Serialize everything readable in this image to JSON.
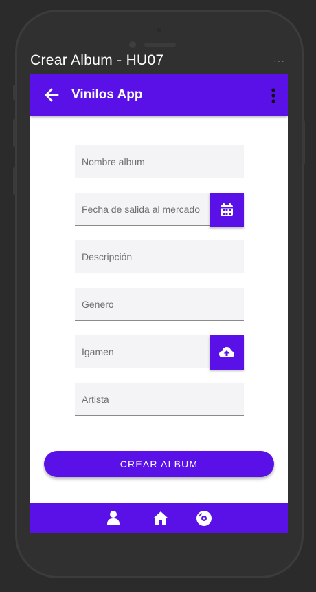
{
  "frame": {
    "title": "Crear Album - HU07",
    "dots": "···"
  },
  "appbar": {
    "title": "Vinilos App",
    "back_icon": "arrow-left-icon",
    "menu_icon": "more-vertical-icon"
  },
  "form": {
    "fields": [
      {
        "placeholder": "Nombre album"
      },
      {
        "placeholder": "Fecha de salida al mercado",
        "action_icon": "calendar-icon"
      },
      {
        "placeholder": "Descripción"
      },
      {
        "placeholder": "Genero"
      },
      {
        "placeholder": "Igamen",
        "action_icon": "cloud-upload-icon"
      },
      {
        "placeholder": "Artista"
      }
    ],
    "submit_label": "CREAR ALBUM"
  },
  "bottom_nav": {
    "items": [
      "user-icon",
      "home-icon",
      "album-disc-icon"
    ]
  },
  "colors": {
    "primary": "#5a11e8",
    "frame": "#303030",
    "field_bg": "#f4f4f6"
  }
}
